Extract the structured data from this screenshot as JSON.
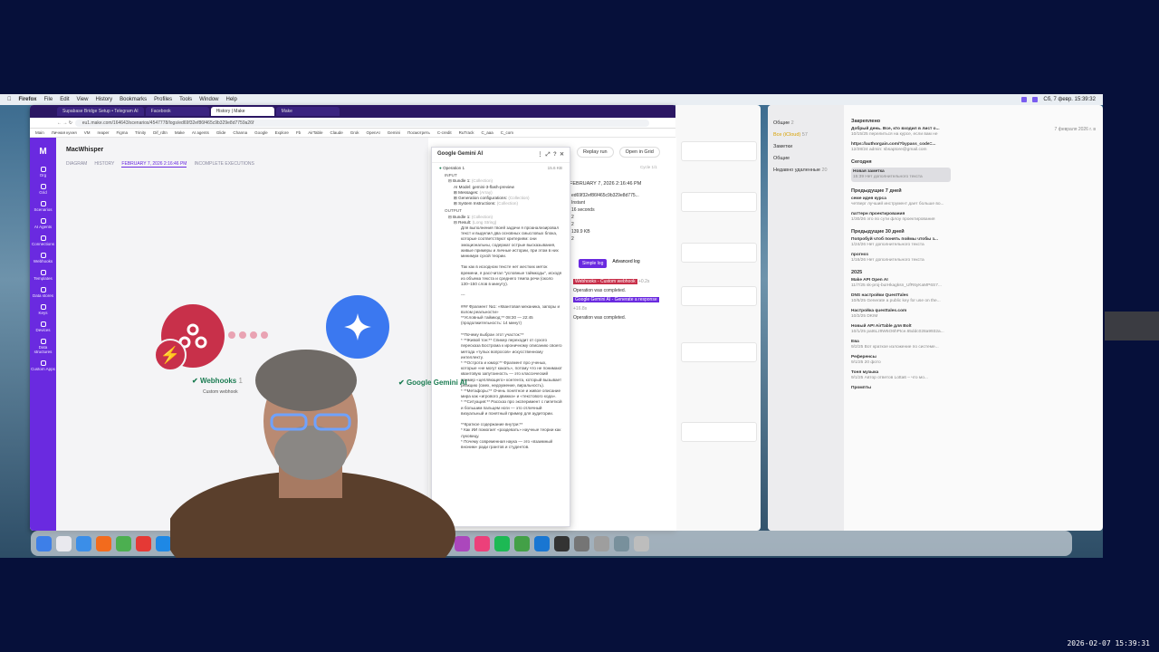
{
  "menubar": {
    "app": "Firefox",
    "items": [
      "File",
      "Edit",
      "View",
      "History",
      "Bookmarks",
      "Profiles",
      "Tools",
      "Window",
      "Help"
    ],
    "clock": "Сб, 7 февр.  15:39:32"
  },
  "browser": {
    "tabs": [
      "Supabase Bridge Setup • Telegram AI",
      "Facebook",
      "History | Make",
      "Make"
    ],
    "active_tab": 2,
    "url": "eu1.make.com/164643/scenarios/4547778/logs/ed69f32ef86f465c9b329e8d7759a26f",
    "bookmarks": [
      "Main",
      "Личная кухня",
      "VM",
      "reaper",
      "Figma",
      "Trinity",
      "Dif_rdtn",
      "Make",
      "AI agents",
      "Glide",
      "Channa",
      "Google",
      "Explore",
      "Fb",
      "AirTable",
      "Claude",
      "Grok",
      "OpenAI",
      "Gemini",
      "Посмотреть",
      "C-credit",
      "RuTrack",
      "C_aaa",
      "C_com"
    ]
  },
  "make": {
    "sidebar": [
      {
        "label": "Org",
        "icon": "org-icon"
      },
      {
        "label": "Grid",
        "icon": "grid-icon"
      },
      {
        "label": "Scenarios",
        "icon": "scenarios-icon"
      },
      {
        "label": "AI Agents",
        "icon": "ai-agents-icon"
      },
      {
        "label": "Connections",
        "icon": "connections-icon"
      },
      {
        "label": "Webhooks",
        "icon": "webhooks-icon"
      },
      {
        "label": "Templates",
        "icon": "templates-icon"
      },
      {
        "label": "Data stores",
        "icon": "data-stores-icon"
      },
      {
        "label": "Keys",
        "icon": "keys-icon"
      },
      {
        "label": "Devices",
        "icon": "devices-icon"
      },
      {
        "label": "Data structures",
        "icon": "data-structures-icon"
      },
      {
        "label": "Custom Apps",
        "icon": "custom-apps-icon"
      }
    ],
    "scenario_title": "MacWhisper",
    "tabs": [
      "DIAGRAM",
      "HISTORY",
      "FEBRUARY 7, 2026 2:16:46 PM",
      "INCOMPLETE EXECUTIONS"
    ],
    "webhook_label": "Webhooks",
    "webhook_count": "1",
    "webhook_sub": "Custom webhook",
    "gemini_label": "Google Gemini AI",
    "execution": {
      "buttons": [
        "Replay run",
        "Open in Grid"
      ],
      "cycle": "Cycle 1/1",
      "date": "FEBRUARY 7, 2026 2:16:46 PM",
      "id": "ed69f32ef86f465c9b329e8d775...",
      "meta": [
        "Instant",
        "16 seconds",
        "2",
        "2",
        "139.9 KB",
        "2"
      ],
      "log_simple": "Simple log",
      "log_advanced": "Advanced log",
      "log_1": "Webhooks - Custom webhook",
      "log_1_time": "+0.2s",
      "log_1_status": "Operation was completed.",
      "log_2": "Google Gemini AI - Generate a response",
      "log_2_time": "+16.8s",
      "log_2_status": "Operation was completed."
    }
  },
  "popup": {
    "title": "Google Gemini AI",
    "op": "Operation 1",
    "size": "15.6 KB",
    "input": "INPUT",
    "bundle_in": "Bundle 1:",
    "bundle_in_type": "(Collection)",
    "model": "AI Model: gemini-3-flash-preview",
    "messages": "Messages:",
    "messages_type": "(Array)",
    "gen_conf": "Generation configurations:",
    "gen_conf_type": "(Collection)",
    "sys_instr": "System Instructions:",
    "sys_instr_type": "(Collection)",
    "output": "OUTPUT",
    "bundle_out": "Bundle 1:",
    "bundle_out_type": "(Collection)",
    "result": "Result:",
    "result_type": "(Long String)",
    "p1": "Для выполнения твоей задачи я проанализировал текст и выделил два основных смысловых блока, которые соответствуют критериям: они эмоциональны, содержат острые высказывания, живые примеры и личные истории, при этом в них минимум сухой теории.",
    "p2": "Так как в исходном тексте нет жестких меток времени, я рассчитал \"условные таймкоды\", исходя из объема текста и среднего темпа речи (около 130–150 слов в минуту).",
    "sep": "---",
    "p3": "### Фрагмент №1: «Квантовая механика, запоры и взлом реальности»",
    "p4": "**Условный таймкод:** 08:30 — 22:45 (продолжительность: 14 минут)",
    "p5": "**Почему выбран этот участок:**",
    "p6": "* **Живой тон:** Спикер переходит от сухого пересказа Бострома к ироничному описанию своего метода «тупых вопросов» искусственному интеллекту.",
    "p7": "* **Острота и юмор:** Фрагмент про ученых, которые «не могут какать», потому что не понимают квантовую запутанность — это классический пример «цепляющего» контента, который вызывает реакцию (смех, недоумение, виральность).",
    "p8": "* **Метафоры:** Очень понятное и живое описание мира как «игрового движка» и «текстового кода».",
    "p9": "* **Ситуация:** Рассказ про эксперимент с пипеткой и большим пальцем ноги — это отличный визуальный и понятный пример для аудитории.",
    "p10": "**Краткое содержание внутри:**",
    "p11": "* Как ИИ помогает «раздевать» научные теории как луковицу.",
    "p12": "* Почему современная наука — это «взаимный вноним» ради грантов и студентов."
  },
  "notes": {
    "folders": [
      "Общие",
      "Все (iCloud)",
      "Заметки",
      "Общие",
      "Недавно удаленные"
    ],
    "folder_counts": [
      "2",
      "57",
      "",
      "",
      "20"
    ],
    "date_header": "7 февраля 2026 г. в",
    "pinned": "Закреплено",
    "groups": [
      {
        "title": "",
        "items": [
          {
            "t": "Добрый день. Все, кто входил в лист о...",
            "s": "10/15/25  перелиться на курсе, если вам не"
          },
          {
            "t": "https://authorgain.com/?bypass_code=...",
            "s": "12/28/24  admin: sbsaptore@gmail.com"
          }
        ]
      },
      {
        "title": "Сегодня",
        "items": [
          {
            "t": "Новая заметка",
            "s": "15:39  Нет дополнительного текста",
            "sel": true
          }
        ]
      },
      {
        "title": "Предыдущие 7 дней",
        "items": [
          {
            "t": "семе идея курса",
            "s": "четверг  лучший инструмент дает больше во..."
          },
          {
            "t": "паттерн проектирования",
            "s": "1/30/26  это по сути флоу проектирования"
          }
        ]
      },
      {
        "title": "Предыдущие 30 дней",
        "items": [
          {
            "t": "Попробуй чтоб понять поймы чтобы з...",
            "s": "1/24/26  Нет дополнительного текста"
          },
          {
            "t": "прогноз",
            "s": "1/16/26  Нет дополнительного текста"
          }
        ]
      },
      {
        "title": "2025",
        "items": [
          {
            "t": "Make API Open AI",
            "s": "11/7/25  sk-proj-buIHkagksn_UfR6yKaMP6S7..."
          },
          {
            "t": "DNS настройки QuestTales",
            "s": "10/6/25  Generate a public key for use on the..."
          },
          {
            "t": "Настройка questtales.com",
            "s": "10/2/25  DKIM"
          },
          {
            "t": "Новый API AirTable для Bolt",
            "s": "10/1/25  pat6Lz9W5O6hPtce.65ddc028a9932a..."
          },
          {
            "t": "Ева",
            "s": "9/2/25  Вот краткое изложение по системе..."
          },
          {
            "t": "Референсы",
            "s": "9/1/25  20 фото"
          },
          {
            "t": "Тоня музыка",
            "s": "9/1/25  Автор ответов Lotta6 – что мо..."
          },
          {
            "t": "Промпты",
            "s": ""
          }
        ]
      }
    ]
  },
  "overlay_clock": "2026-02-07  15:39:31",
  "colors": {
    "make_purple": "#6a2ae0",
    "webhook_red": "#c8304a",
    "gemini_blue": "#3b78f0",
    "success_green": "#1b7c52"
  }
}
